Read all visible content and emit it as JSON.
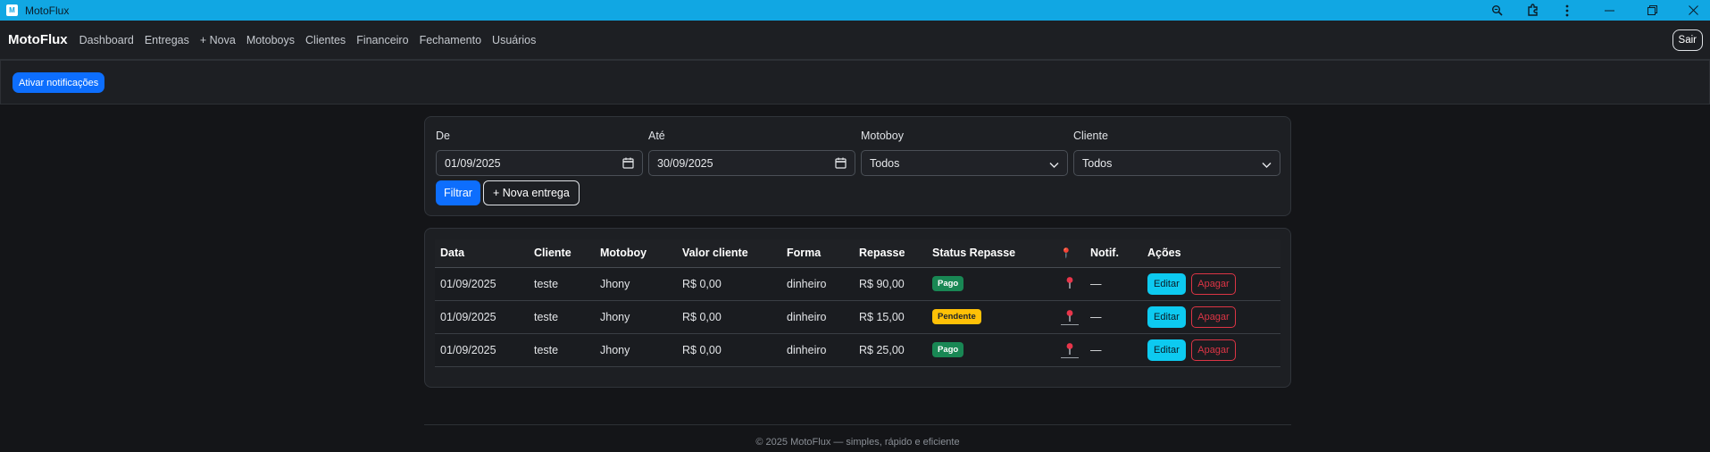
{
  "window": {
    "title": "MotoFlux",
    "icon_letter": "M",
    "controls": [
      "zoom-icon",
      "extensions-icon",
      "more-icon",
      "minimize-icon",
      "restore-icon",
      "close-icon"
    ]
  },
  "navbar": {
    "brand": "MotoFlux",
    "links": [
      "Dashboard",
      "Entregas",
      "+ Nova",
      "Motoboys",
      "Clientes",
      "Financeiro",
      "Fechamento",
      "Usuários"
    ],
    "logout_label": "Sair"
  },
  "notifications": {
    "button_label": "Ativar notificações"
  },
  "filters": {
    "from": {
      "label": "De",
      "value": "01/09/2025",
      "icon": "calendar-icon"
    },
    "to": {
      "label": "Até",
      "value": "30/09/2025",
      "icon": "calendar-icon"
    },
    "motoboy": {
      "label": "Motoboy",
      "value": "Todos",
      "icon": "chevron-down-icon"
    },
    "client": {
      "label": "Cliente",
      "value": "Todos",
      "icon": "chevron-down-icon"
    },
    "filter_button": "Filtrar",
    "new_delivery_button": "+ Nova entrega"
  },
  "table": {
    "headers": [
      "Data",
      "Cliente",
      "Motoboy",
      "Valor cliente",
      "Forma",
      "Repasse",
      "Status Repasse",
      "📍",
      "Notif.",
      "Ações"
    ],
    "rows": [
      {
        "date": "01/09/2025",
        "client": "teste",
        "motoboy": "Jhony",
        "client_value": "R$ 0,00",
        "method": "dinheiro",
        "payout": "R$ 90,00",
        "status": "Pago",
        "status_color": "#198754",
        "location_icon": "map-pin-icon",
        "notif": "—",
        "edit": "Editar",
        "delete": "Apagar"
      },
      {
        "date": "01/09/2025",
        "client": "teste",
        "motoboy": "Jhony",
        "client_value": "R$ 0,00",
        "method": "dinheiro",
        "payout": "R$ 15,00",
        "status": "Pendente",
        "status_color": "#ffc107",
        "location_icon": "map-pin-link-icon",
        "notif": "—",
        "edit": "Editar",
        "delete": "Apagar"
      },
      {
        "date": "01/09/2025",
        "client": "teste",
        "motoboy": "Jhony",
        "client_value": "R$ 0,00",
        "method": "dinheiro",
        "payout": "R$ 25,00",
        "status": "Pago",
        "status_color": "#198754",
        "location_icon": "map-pin-link-icon",
        "notif": "—",
        "edit": "Editar",
        "delete": "Apagar"
      }
    ]
  },
  "footer": {
    "text": "© 2025 MotoFlux — simples, rápido e eficiente"
  },
  "colors": {
    "titlebar": "#11a7e3",
    "background": "#141518",
    "card": "#1d1f23",
    "primary": "#0d6efd",
    "info": "#0dcaf0",
    "danger": "#dc3545",
    "success": "#198754",
    "warning": "#ffc107"
  }
}
